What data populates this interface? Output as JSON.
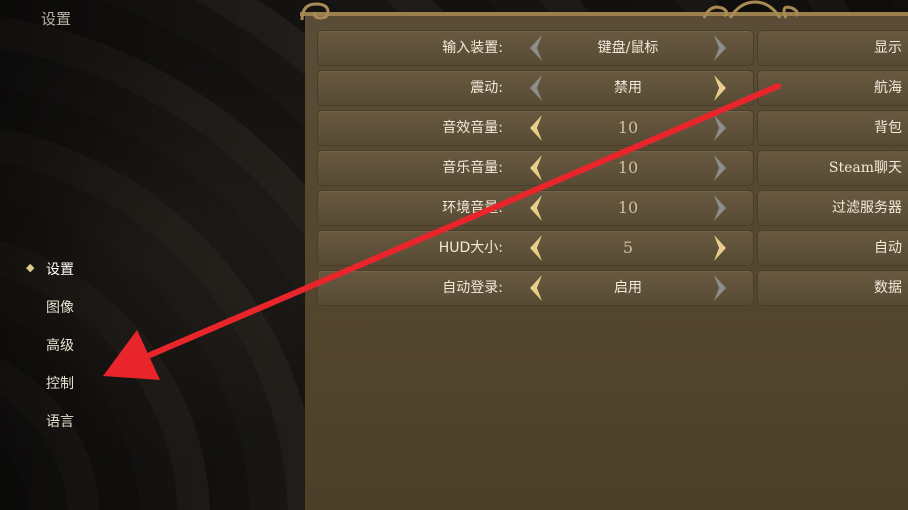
{
  "page_title": "设置",
  "nav": {
    "items": [
      {
        "label": "设置",
        "active": true
      },
      {
        "label": "图像",
        "active": false
      },
      {
        "label": "高级",
        "active": false
      },
      {
        "label": "控制",
        "active": false
      },
      {
        "label": "语言",
        "active": false
      }
    ]
  },
  "settings_left": [
    {
      "label": "输入装置:",
      "value": "键盘/鼠标"
    },
    {
      "label": "震动:",
      "value": "禁用"
    },
    {
      "label": "音效音量:",
      "value": "10"
    },
    {
      "label": "音乐音量:",
      "value": "10"
    },
    {
      "label": "环境音量:",
      "value": "10"
    },
    {
      "label": "HUD大小:",
      "value": "5"
    },
    {
      "label": "自动登录:",
      "value": "启用"
    }
  ],
  "settings_right": [
    {
      "label": "显示"
    },
    {
      "label": "航海"
    },
    {
      "label": "背包"
    },
    {
      "label": "Steam聊天"
    },
    {
      "label": "过滤服务器"
    },
    {
      "label": "自动"
    },
    {
      "label": "数据"
    }
  ],
  "colors": {
    "accent_gold": "#e8d08a",
    "arrow_grey": "#8d8d8d",
    "annotation_red": "#e8252b"
  }
}
